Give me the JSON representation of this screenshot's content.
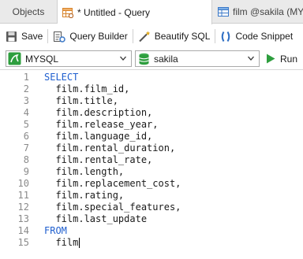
{
  "tabs": {
    "objects": "Objects",
    "active": "* Untitled - Query",
    "other": "film @sakila (MY"
  },
  "toolbar": {
    "save": "Save",
    "query_builder": "Query Builder",
    "beautify": "Beautify SQL",
    "code_snippet": "Code Snippet"
  },
  "selectors": {
    "connection": "MYSQL",
    "database": "sakila",
    "run": "Run"
  },
  "editor": {
    "lines": [
      {
        "n": "1",
        "text": "SELECT",
        "keyword": true
      },
      {
        "n": "2",
        "text": "  film.film_id,",
        "keyword": false
      },
      {
        "n": "3",
        "text": "  film.title,",
        "keyword": false
      },
      {
        "n": "4",
        "text": "  film.description,",
        "keyword": false
      },
      {
        "n": "5",
        "text": "  film.release_year,",
        "keyword": false
      },
      {
        "n": "6",
        "text": "  film.language_id,",
        "keyword": false
      },
      {
        "n": "7",
        "text": "  film.rental_duration,",
        "keyword": false
      },
      {
        "n": "8",
        "text": "  film.rental_rate,",
        "keyword": false
      },
      {
        "n": "9",
        "text": "  film.length,",
        "keyword": false
      },
      {
        "n": "10",
        "text": "  film.replacement_cost,",
        "keyword": false
      },
      {
        "n": "11",
        "text": "  film.rating,",
        "keyword": false
      },
      {
        "n": "12",
        "text": "  film.special_features,",
        "keyword": false
      },
      {
        "n": "13",
        "text": "  film.last_update",
        "keyword": false
      },
      {
        "n": "14",
        "text": "FROM",
        "keyword": true
      },
      {
        "n": "15",
        "text": "  film",
        "keyword": false
      }
    ]
  },
  "colors": {
    "keyword": "#1f5fcf",
    "connection_icon": "#2e9e3e",
    "run_icon": "#2e9e3e"
  }
}
